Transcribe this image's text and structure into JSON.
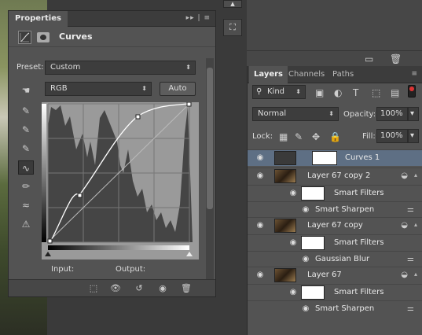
{
  "properties": {
    "tab": "Properties",
    "title": "Curves",
    "preset_label": "Preset:",
    "preset_value": "Custom",
    "channel_value": "RGB",
    "auto_label": "Auto",
    "input_label": "Input:",
    "output_label": "Output:"
  },
  "layers_panel": {
    "tabs": [
      "Layers",
      "Channels",
      "Paths"
    ],
    "filter_kind": "Kind",
    "blend_mode": "Normal",
    "opacity_label": "Opacity:",
    "opacity_value": "100%",
    "lock_label": "Lock:",
    "fill_label": "Fill:",
    "fill_value": "100%",
    "layers": [
      {
        "name": "Curves 1"
      },
      {
        "name": "Layer 67 copy 2"
      },
      {
        "name": "Smart Filters"
      },
      {
        "name": "Smart Sharpen"
      },
      {
        "name": "Layer 67 copy"
      },
      {
        "name": "Smart Filters"
      },
      {
        "name": "Gaussian Blur"
      },
      {
        "name": "Layer 67"
      },
      {
        "name": "Smart Filters"
      },
      {
        "name": "Smart Sharpen"
      }
    ]
  },
  "colors": {
    "selected_row": "#5e6f84",
    "panel_bg": "#535353",
    "accent": "#d33"
  }
}
